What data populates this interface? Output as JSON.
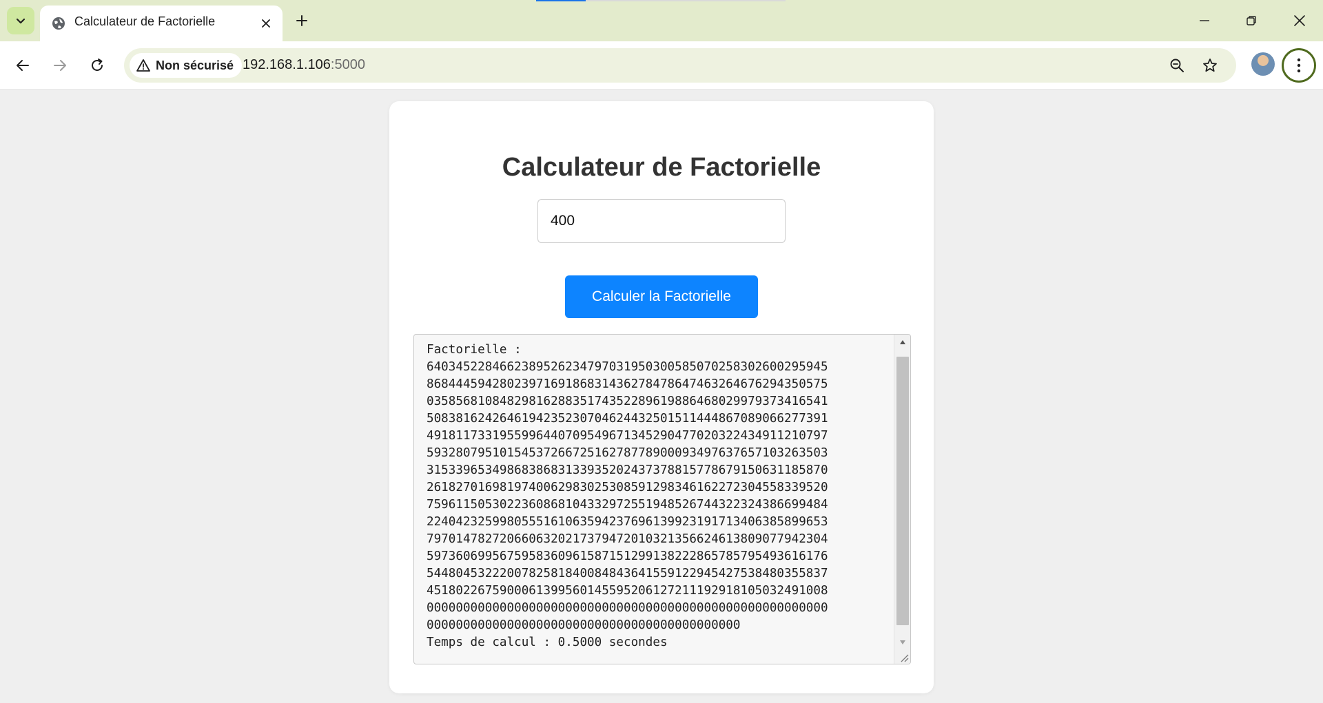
{
  "browser": {
    "tab": {
      "title": "Calculateur de Factorielle"
    },
    "address_bar": {
      "security_label": "Non sécurisé",
      "url_host": "192.168.1.106",
      "url_port": ":5000"
    },
    "page_load_progress": 0.2
  },
  "page": {
    "title": "Calculateur de Factorielle",
    "input": {
      "value": "400"
    },
    "calculate_button": {
      "label": "Calculer la Factorielle"
    },
    "result": {
      "label": "Factorielle :",
      "digits_lines": [
        "6403452284662389526234797031950300585070258302600295945",
        "8684445942802397169186831436278478647463264676294350575",
        "0358568108482981628835174352289619886468029979373416541",
        "5083816242646194235230704624432501511444867089066277391",
        "4918117331955996440709549671345290477020322434911210797",
        "5932807951015453726672516278778900093497637657103263503",
        "3153396534986838683133935202437378815778679150631185870",
        "2618270169819740062983025308591298346162272304558339520",
        "7596115053022360868104332972551948526744322324386699484",
        "2240423259980555161063594237696139923191713406385899653",
        "7970147827206606320217379472010321356624613809077942304",
        "5973606995675958360961587151299138222865785795493616176",
        "5448045322200782581840084843641559122945427538480355837",
        "4518022675900061399560145595206127211192918105032491008",
        "0000000000000000000000000000000000000000000000000000000",
        "0000000000000000000000000000000000000000000"
      ],
      "time_text": "Temps de calcul : 0.5000 secondes"
    }
  },
  "colors": {
    "tabbar_bg": "#e3ebcc",
    "button_bg": "#0d84ff",
    "page_bg": "#efefef"
  }
}
